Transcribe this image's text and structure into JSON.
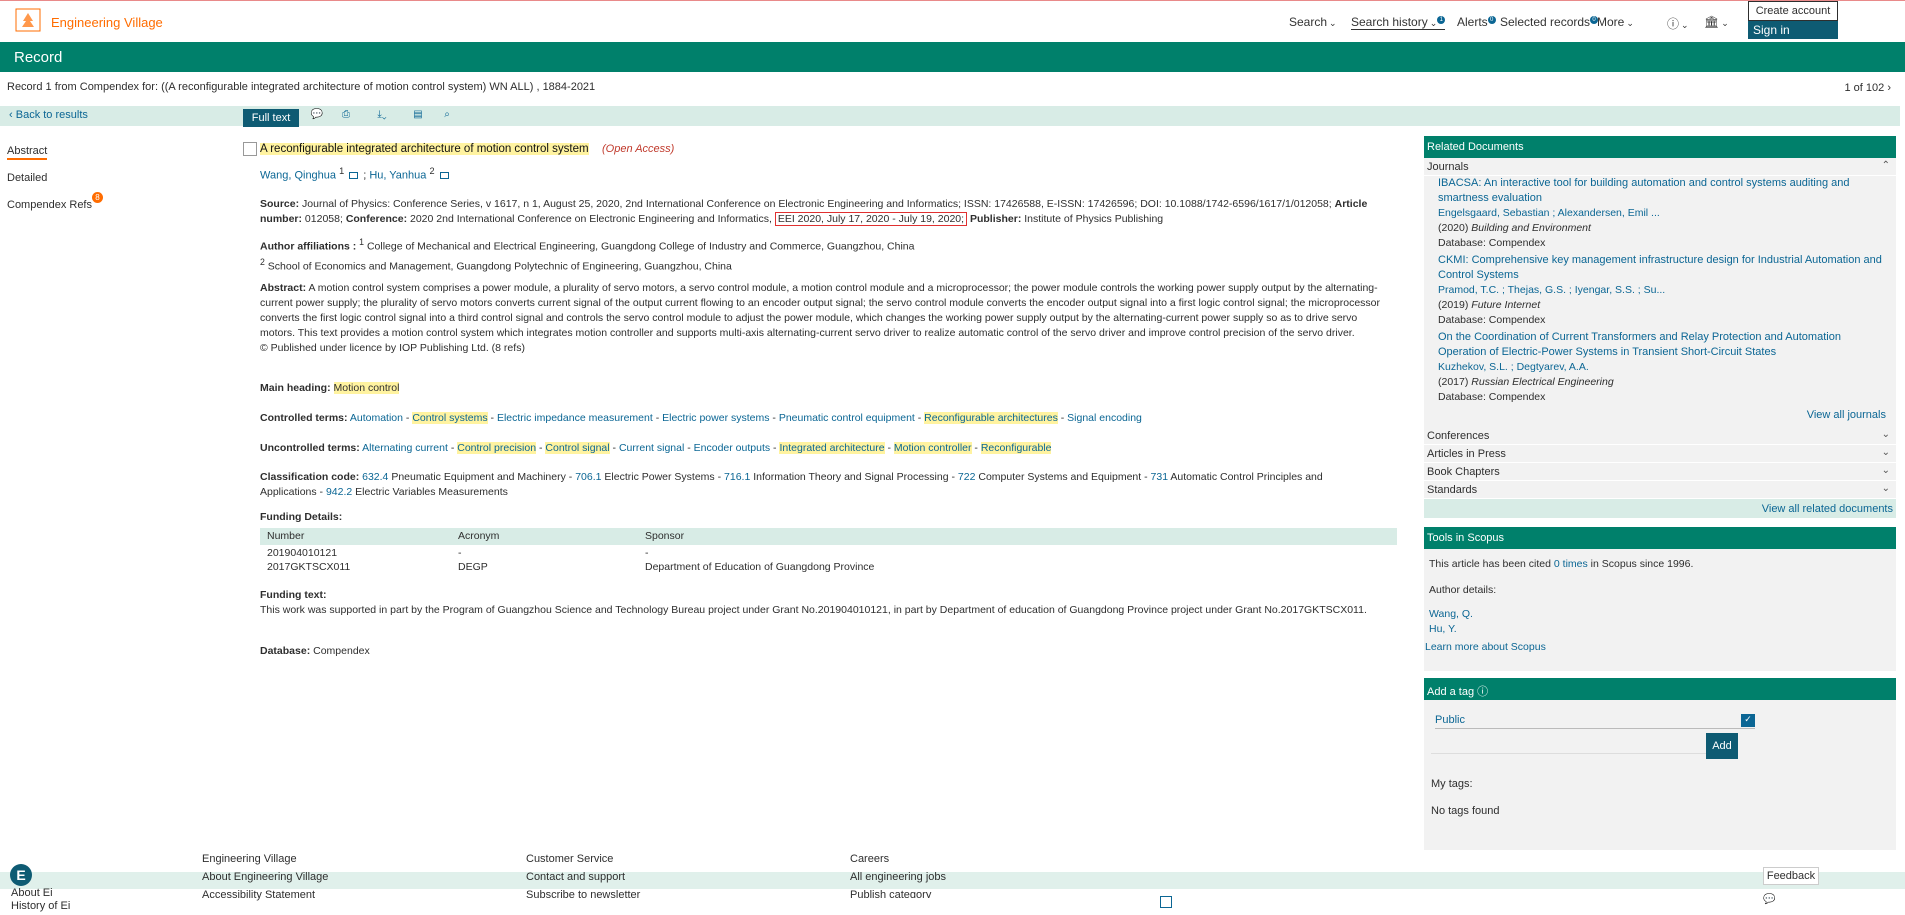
{
  "header": {
    "brand": "Engineering Village",
    "nav": [
      "Search",
      "Search history",
      "Alerts",
      "Selected records",
      "More"
    ],
    "search_history_count": "1",
    "alerts_count": "0",
    "selected_count": "0",
    "create_account": "Create account",
    "sign_in": "Sign in"
  },
  "record_bar": {
    "title": "Record"
  },
  "record_info": {
    "text": "Record 1 from Compendex for: ((A reconfigurable integrated architecture of motion control system) WN ALL) , 1884-2021",
    "position": "1 of 102"
  },
  "toolbar": {
    "back": "Back to results",
    "full_text": "Full text"
  },
  "sidenav": {
    "abstract": "Abstract",
    "detailed": "Detailed",
    "refs": "Compendex Refs",
    "refs_count": "8"
  },
  "record": {
    "title": "A reconfigurable integrated architecture of motion control system",
    "open_access": "(Open Access)",
    "author1": "Wang, Qinghua",
    "author1_sup": "1",
    "author2": "Hu, Yanhua",
    "author2_sup": "2",
    "source_label": "Source:",
    "source_text": "Journal of Physics: Conference Series, v 1617, n 1, August 25, 2020, 2nd International Conference on Electronic Engineering and Informatics;  ISSN: 17426588,  E-ISSN: 17426596;  DOI: 10.1088/1742-6596/1617/1/012058;",
    "article_label": "Article number:",
    "article_num": "012058;",
    "conf_label": "Conference:",
    "conf_text": "2020 2nd International Conference on Electronic Engineering and Informatics,",
    "conf_dates": "EEI 2020, July 17, 2020 - July 19, 2020;",
    "publisher_label": "Publisher:",
    "publisher": "Institute of Physics Publishing",
    "aff_label": "Author affiliations :",
    "aff1_sup": "1",
    "aff1": "College of Mechanical and Electrical Engineering, Guangdong College of Industry and Commerce, Guangzhou, China",
    "aff2_sup": "2",
    "aff2": "School of Economics and Management, Guangdong Polytechnic of Engineering, Guangzhou, China",
    "abstract_label": "Abstract:",
    "abstract": "A motion control system comprises a power module, a plurality of servo motors, a servo control module, a motion control module and a microprocessor; the power module controls the working power supply output by the alternating-current power supply; the plurality of servo motors converts current signal of the output current flowing to an encoder output signal; the servo control module converts the encoder output signal into a first logic control signal; the microprocessor converts the first logic control signal into a third control signal and controls the servo control module to adjust the power module, which changes the working power supply output by the alternating-current power supply so as to drive servo motors. This text provides a motion control system which integrates motion controller and supports multi-axis alternating-current servo driver to realize automatic control of the servo driver and improve control precision of the servo driver.",
    "copyright": "© Published under licence by IOP Publishing Ltd. (8 refs)",
    "main_heading_label": "Main heading:",
    "main_heading": "Motion control",
    "controlled_label": "Controlled terms:",
    "controlled": [
      "Automation",
      "Control systems",
      "Electric impedance measurement",
      "Electric power systems",
      "Pneumatic control equipment",
      "Reconfigurable architectures",
      "Signal encoding"
    ],
    "uncontrolled_label": "Uncontrolled terms:",
    "uncontrolled": [
      "Alternating current",
      "Control precision",
      "Control signal",
      "Current signal",
      "Encoder outputs",
      "Integrated architecture",
      "Motion controller",
      "Reconfigurable"
    ],
    "class_label": "Classification code:",
    "class_codes": [
      {
        "code": "632.4",
        "text": "Pneumatic Equipment and Machinery"
      },
      {
        "code": "706.1",
        "text": "Electric Power Systems"
      },
      {
        "code": "716.1",
        "text": "Information Theory and Signal Processing"
      },
      {
        "code": "722",
        "text": "Computer Systems and Equipment"
      },
      {
        "code": "731",
        "text": "Automatic Control Principles and Applications"
      },
      {
        "code": "942.2",
        "text": "Electric Variables Measurements"
      }
    ],
    "funding_label": "Funding Details:",
    "funding_cols": [
      "Number",
      "Acronym",
      "Sponsor"
    ],
    "funding_rows": [
      [
        "201904010121",
        "-",
        "-"
      ],
      [
        "2017GKTSCX011",
        "DEGP",
        "Department of Education of Guangdong Province"
      ]
    ],
    "funding_text_label": "Funding text:",
    "funding_text": "This work was supported in part by the Program of Guangzhou Science and Technology Bureau project under Grant No.201904010121, in part by Department of education of Guangdong Province project under Grant No.2017GKTSCX011.",
    "database_label": "Database:",
    "database": "Compendex"
  },
  "related": {
    "title": "Related Documents",
    "journals_label": "Journals",
    "journals": [
      {
        "title": "IBACSA: An interactive tool for building automation and control systems auditing and smartness evaluation",
        "authors": "Engelsgaard, Sebastian ; Alexandersen, Emil ...",
        "year": "(2020)",
        "source": "Building and Environment",
        "db": "Database: Compendex"
      },
      {
        "title": "CKMI: Comprehensive key management infrastructure design for Industrial Automation and Control Systems",
        "authors": "Pramod, T.C. ; Thejas, G.S. ; Iyengar, S.S. ; Su...",
        "year": "(2019)",
        "source": "Future Internet",
        "db": "Database: Compendex"
      },
      {
        "title": "On the Coordination of Current Transformers and Relay Protection and Automation Operation of Electric-Power Systems in Transient Short-Circuit States",
        "authors": "Kuzhekov, S.L. ; Degtyarev, A.A.",
        "year": "(2017)",
        "source": "Russian Electrical Engineering",
        "db": "Database: Compendex"
      }
    ],
    "view_all_journals": "View all journals",
    "sections": [
      "Conferences",
      "Articles in Press",
      "Book Chapters",
      "Standards"
    ],
    "view_all": "View all related documents"
  },
  "scopus": {
    "title": "Tools in Scopus",
    "cited_pre": "This article has been cited",
    "cited_link": "0 times",
    "cited_post": "in Scopus since 1996.",
    "author_details": "Author details:",
    "authors": [
      "Wang, Q.",
      "Hu, Y."
    ],
    "learn_more": "Learn more about Scopus"
  },
  "tags": {
    "title": "Add a tag",
    "public": "Public",
    "add": "Add",
    "my_tags": "My tags:",
    "none": "No tags found"
  },
  "footer": {
    "col1": [
      "Engineering Village",
      "About Engineering Village",
      "Accessibility Statement"
    ],
    "col0": [
      "About Ei",
      "History of Ei"
    ],
    "col2": [
      "Customer Service",
      "Contact and support",
      "Subscribe to newsletter"
    ],
    "col3": [
      "Careers",
      "All engineering jobs",
      "Publish category"
    ],
    "feedback": "Feedback"
  },
  "colors": {
    "brand_orange": "#ff6c00",
    "teal": "#00806b",
    "link": "#0b6694"
  }
}
